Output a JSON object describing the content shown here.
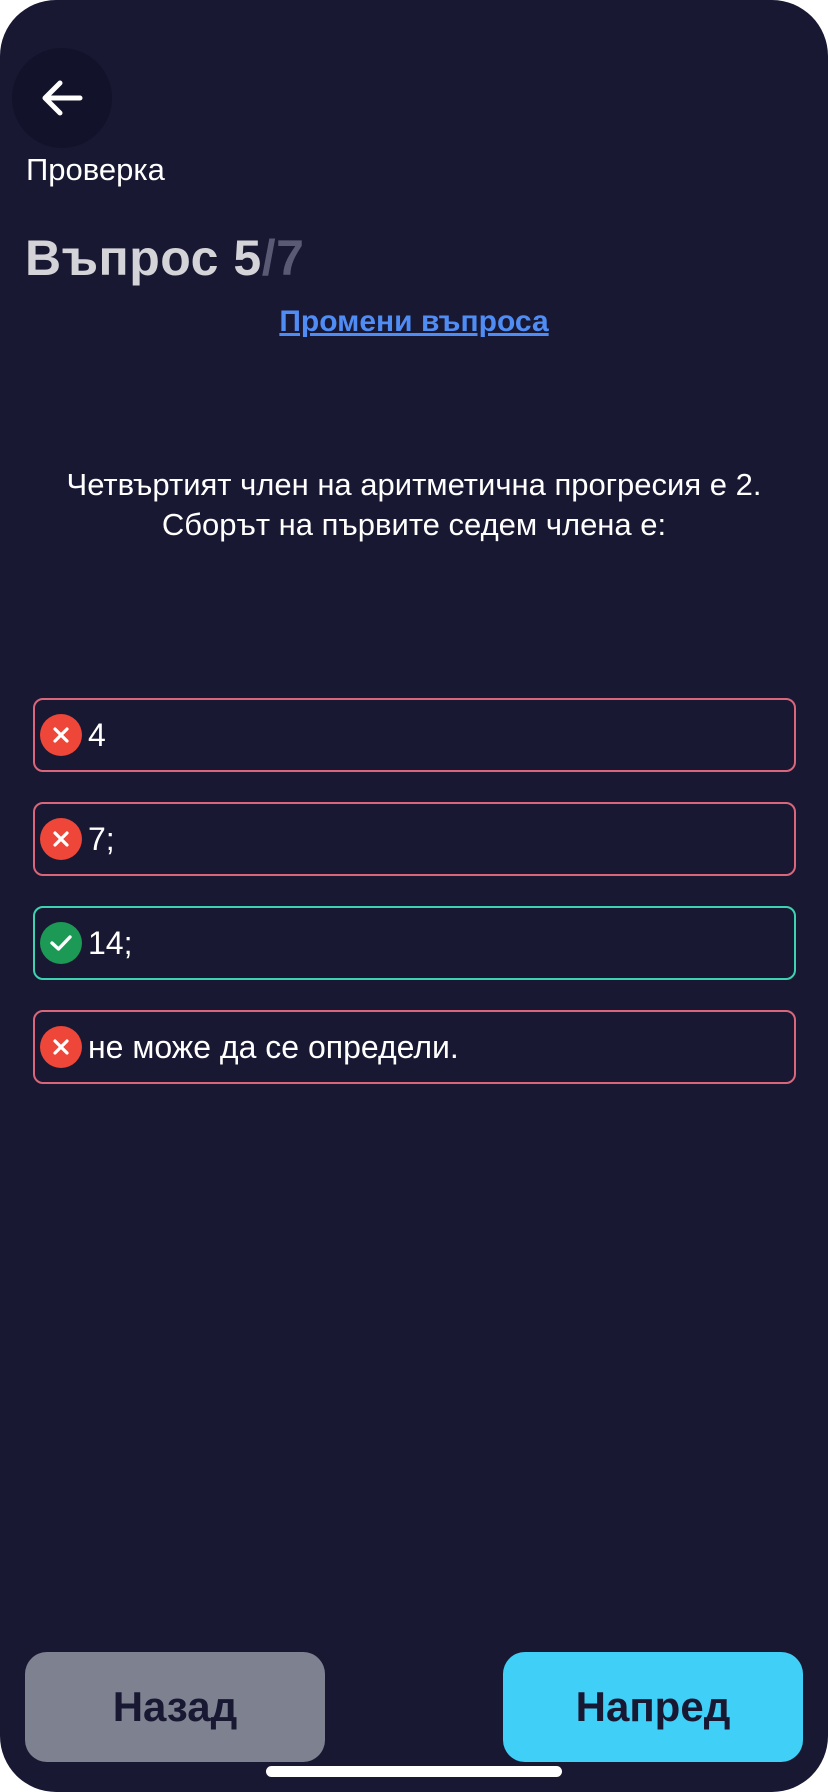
{
  "header": {
    "back_icon": "arrow-left-icon",
    "title": "Проверка"
  },
  "question": {
    "heading_prefix": "Въпрос ",
    "current": "5",
    "total": "/7",
    "change_link": "Промени въпроса",
    "text_line1": "Четвъртият член на аритметична прогресия е 2.",
    "text_line2": "Сборът на първите седем члена е:"
  },
  "answers": [
    {
      "label": "4",
      "status": "wrong",
      "icon": "x-circle-icon"
    },
    {
      "label": "7;",
      "status": "wrong",
      "icon": "x-circle-icon"
    },
    {
      "label": "14;",
      "status": "correct",
      "icon": "check-circle-icon"
    },
    {
      "label": "не може да се определи.",
      "status": "wrong",
      "icon": "x-circle-icon"
    }
  ],
  "footer": {
    "prev_label": "Назад",
    "next_label": "Напред"
  },
  "colors": {
    "background": "#181833",
    "accent": "#40cff6",
    "link": "#4f8cf4",
    "wrong": "#ee4638",
    "correct": "#1c9a55"
  }
}
